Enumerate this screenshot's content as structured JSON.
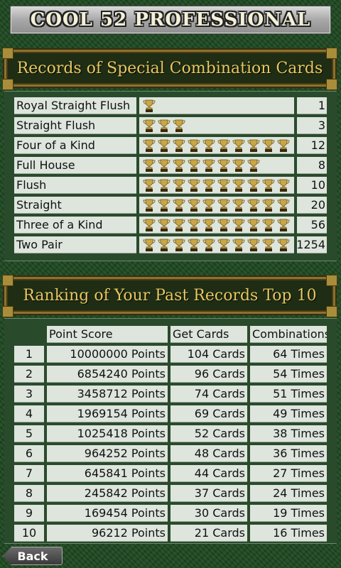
{
  "app_title": "COOL 52 PROFESSIONAL",
  "records": {
    "title": "Records of Special Combination Cards",
    "rows": [
      {
        "name": "Royal Straight Flush",
        "trophies": 1,
        "count": "1"
      },
      {
        "name": "Straight Flush",
        "trophies": 3,
        "count": "3"
      },
      {
        "name": "Four of a Kind",
        "trophies": 10,
        "count": "12"
      },
      {
        "name": "Full House",
        "trophies": 8,
        "count": "8"
      },
      {
        "name": "Flush",
        "trophies": 10,
        "count": "10"
      },
      {
        "name": "Straight",
        "trophies": 10,
        "count": "20"
      },
      {
        "name": "Three of a Kind",
        "trophies": 10,
        "count": "56"
      },
      {
        "name": "Two Pair",
        "trophies": 10,
        "count": "1254"
      }
    ]
  },
  "ranking": {
    "title": "Ranking of Your Past Records Top 10",
    "headers": {
      "score": "Point Score",
      "cards": "Get Cards",
      "combos": "Combinations"
    },
    "rows": [
      {
        "rank": "1",
        "score": "10000000 Points",
        "cards": "104 Cards",
        "combos": "64 Times"
      },
      {
        "rank": "2",
        "score": "6854240 Points",
        "cards": "96 Cards",
        "combos": "54 Times"
      },
      {
        "rank": "3",
        "score": "3458712 Points",
        "cards": "74 Cards",
        "combos": "51 Times"
      },
      {
        "rank": "4",
        "score": "1969154 Points",
        "cards": "69 Cards",
        "combos": "49 Times"
      },
      {
        "rank": "5",
        "score": "1025418 Points",
        "cards": "52 Cards",
        "combos": "38 Times"
      },
      {
        "rank": "6",
        "score": "964252 Points",
        "cards": "48 Cards",
        "combos": "36 Times"
      },
      {
        "rank": "7",
        "score": "645841 Points",
        "cards": "44 Cards",
        "combos": "27 Times"
      },
      {
        "rank": "8",
        "score": "245842 Points",
        "cards": "37 Cards",
        "combos": "24 Times"
      },
      {
        "rank": "9",
        "score": "169454 Points",
        "cards": "30 Cards",
        "combos": "19 Times"
      },
      {
        "rank": "10",
        "score": "96212 Points",
        "cards": "21 Cards",
        "combos": "16 Times"
      }
    ]
  },
  "back_label": "Back",
  "colors": {
    "felt": "#1f4a22",
    "gold": "#e8c860",
    "cell": "#dde5dd"
  }
}
